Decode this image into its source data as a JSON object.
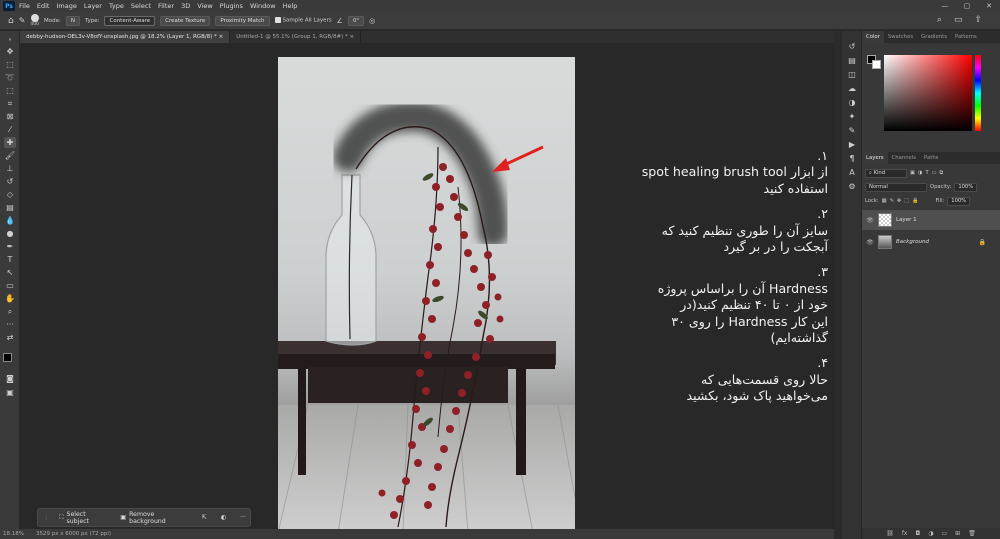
{
  "menubar": {
    "app_badge": "Ps",
    "items": [
      "File",
      "Edit",
      "Image",
      "Layer",
      "Type",
      "Select",
      "Filter",
      "3D",
      "View",
      "Plugins",
      "Window",
      "Help"
    ]
  },
  "options": {
    "brush_size": "400",
    "mode_label": "Mode:",
    "mode_value": "N",
    "type_label": "Type:",
    "content_aware": "Content-Aware",
    "create_texture": "Create Texture",
    "proximity_match": "Proximity Match",
    "sample_all_layers": "Sample All Layers",
    "angle_value": "0°"
  },
  "tabs": [
    {
      "label": "debby-hudson-OEL3v-V8ofY-unsplash.jpg @ 18.2% (Layer 1, RGB/8) *",
      "close": "×"
    },
    {
      "label": "Untitled-1 @ 55.1% (Group 1, RGB/8#) *",
      "close": "×"
    }
  ],
  "statusbar": {
    "zoom": "18.18%",
    "doc_info": "3529 px x 6000 px (72 ppi)"
  },
  "context_bar": {
    "select_subject": "Select subject",
    "remove_background": "Remove background",
    "more": "···"
  },
  "instructions": [
    {
      "num": "۱.",
      "lines": [
        "از ابزار spot healing brush tool",
        "استفاده کنید"
      ]
    },
    {
      "num": "۲.",
      "lines": [
        "سایز آن را طوری تنظیم کنید که",
        "آبجکت را در بر گیرد"
      ]
    },
    {
      "num": "۳.",
      "lines": [
        "Hardness آن را براساس پروژه",
        "خود از ۰ تا ۴۰ تنظیم کنید(در",
        "این کار Hardness را روی ۳۰",
        "گذاشته‌ایم)"
      ]
    },
    {
      "num": "۴.",
      "lines": [
        "حالا روی قسمت‌هایی که",
        "می‌خواهید پاک شود، بکشید"
      ]
    }
  ],
  "color_panel": {
    "tabs": [
      "Color",
      "Swatches",
      "Gradients",
      "Patterns"
    ]
  },
  "layers_panel": {
    "tabs": [
      "Layers",
      "Channels",
      "Paths"
    ],
    "kind_label": "Kind",
    "blend_mode": "Normal",
    "opacity_label": "Opacity:",
    "opacity_value": "100%",
    "lock_label": "Lock:",
    "fill_label": "Fill:",
    "fill_value": "100%",
    "layers": [
      {
        "name": "Layer 1",
        "selected": true
      },
      {
        "name": "Background",
        "selected": false
      }
    ]
  },
  "colors": {
    "accent": "#31a8ff",
    "arrow": "#e2201f"
  }
}
